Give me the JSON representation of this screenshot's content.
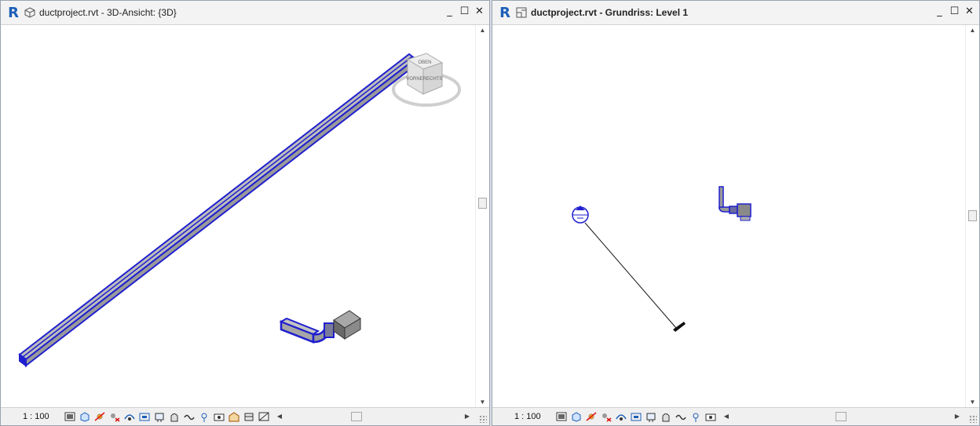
{
  "left_window": {
    "app_logo": "R",
    "title": "ductproject.rvt - 3D-Ansicht: {3D}",
    "scale": "1 : 100",
    "view_cube": {
      "top": "OBEN",
      "left": "VORNE",
      "right": "RECHTS"
    },
    "icons": [
      "detail-level-icon",
      "visual-style-icon",
      "sun-path-icon",
      "shadows-icon",
      "render-icon",
      "crop-view-icon",
      "show-crop-icon",
      "unlock-3d-icon",
      "temporary-hide-icon",
      "reveal-hidden-icon",
      "design-options-icon",
      "analytical-model-icon",
      "highlight-displacement-icon",
      "reveal-constraints-icon"
    ]
  },
  "right_window": {
    "app_logo": "R",
    "title": "ductproject.rvt - Grundriss: Level 1",
    "scale": "1 : 100",
    "icons": [
      "detail-level-icon",
      "visual-style-icon",
      "sun-path-icon",
      "shadows-icon",
      "crop-view-icon",
      "show-crop-icon",
      "temporary-hide-icon",
      "reveal-hidden-icon",
      "design-options-icon",
      "analytical-model-icon",
      "reveal-constraints-icon"
    ]
  },
  "window_controls": {
    "minimize": "_",
    "maximize": "☐",
    "close": "✕"
  },
  "colors": {
    "duct_selected": "#1f1fcf",
    "duct_fill": "#a6a6a6",
    "revit_blue": "#1d5fb8"
  }
}
